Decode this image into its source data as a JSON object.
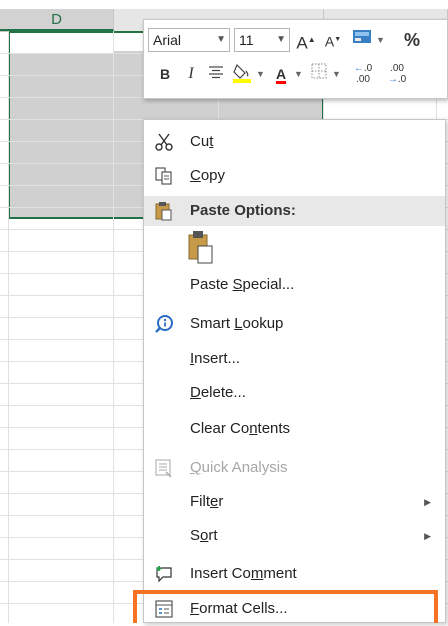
{
  "sheet": {
    "column_headers": [
      "D",
      ""
    ],
    "selected_column": "D"
  },
  "mini_toolbar": {
    "font_name": "Arial",
    "font_size": "11",
    "increase_font": "A",
    "decrease_font": "A",
    "percent": "%",
    "bold": "B",
    "italic": "I",
    "font_color_letter": "A",
    "dec_inc_1": ".0",
    "dec_inc_2": ".00",
    "dec_dec_1": ".00",
    "dec_dec_2": ".0",
    "colors": {
      "highlight": "#ffff00",
      "font_color": "#ff0000",
      "fill": "#217346"
    }
  },
  "context_menu": {
    "items": [
      {
        "id": "cut",
        "pre": "Cu",
        "ul": "t",
        "post": "",
        "icon": "scissors-icon"
      },
      {
        "id": "copy",
        "pre": "",
        "ul": "C",
        "post": "opy",
        "icon": "copy-icon"
      },
      {
        "id": "paste_special",
        "pre": "Paste ",
        "ul": "S",
        "post": "pecial..."
      },
      {
        "id": "smart_lookup",
        "pre": "Smart ",
        "ul": "L",
        "post": "ookup",
        "icon": "smart-lookup-icon"
      },
      {
        "id": "insert",
        "pre": "",
        "ul": "I",
        "post": "nsert..."
      },
      {
        "id": "delete",
        "pre": "",
        "ul": "D",
        "post": "elete..."
      },
      {
        "id": "clear_contents",
        "pre": "Clear Co",
        "ul": "n",
        "post": "tents"
      },
      {
        "id": "quick_analysis",
        "pre": "",
        "ul": "Q",
        "post": "uick Analysis",
        "icon": "quick-analysis-icon",
        "disabled": true
      },
      {
        "id": "filter",
        "pre": "Filt",
        "ul": "e",
        "post": "r"
      },
      {
        "id": "sort",
        "pre": "S",
        "ul": "o",
        "post": "rt"
      },
      {
        "id": "insert_comment",
        "pre": "Insert Co",
        "ul": "m",
        "post": "ment",
        "icon": "comment-icon"
      },
      {
        "id": "format_cells",
        "pre": "",
        "ul": "F",
        "post": "ormat Cells...",
        "icon": "format-cells-icon"
      }
    ],
    "paste_options_header": "Paste Options:",
    "highlight_color": "#f57323"
  }
}
